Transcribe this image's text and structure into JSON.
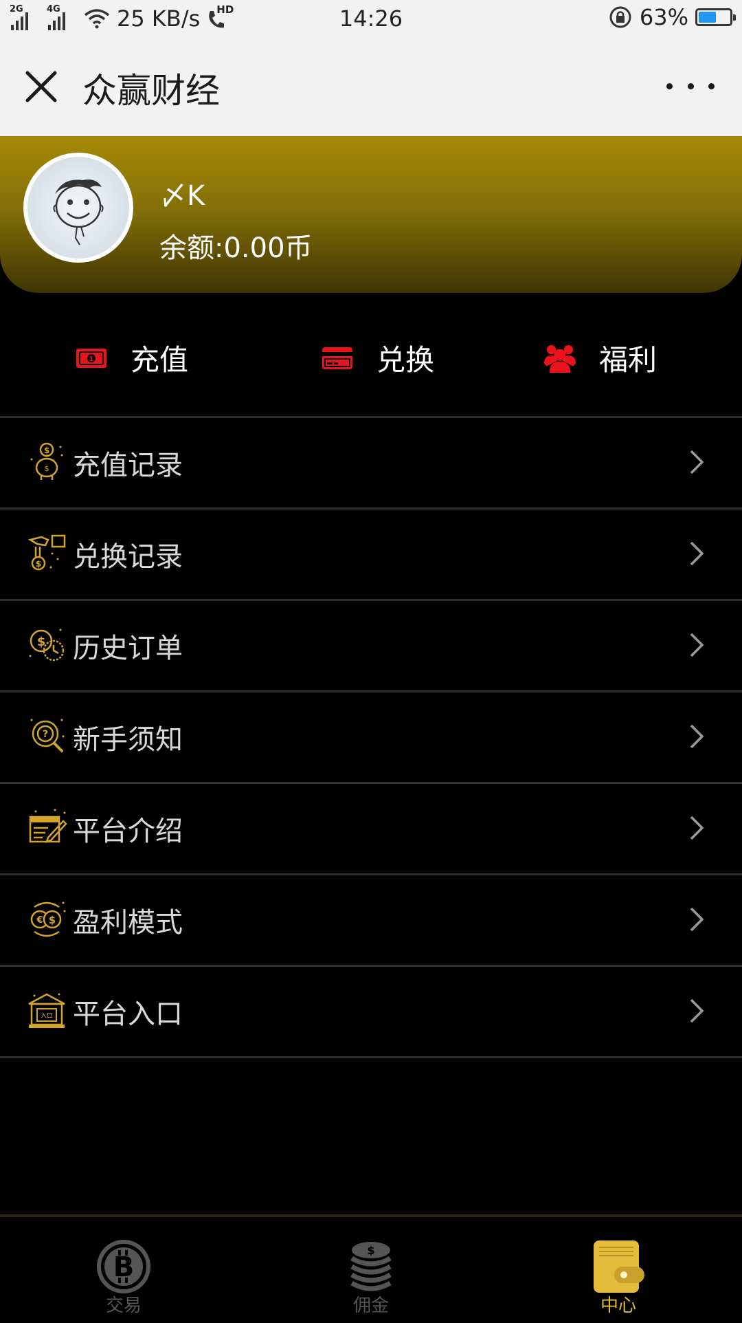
{
  "status_bar": {
    "signal1": "2G",
    "signal2": "4G",
    "net_speed": "25 KB/s",
    "call_badge": "HD",
    "time": "14:26",
    "battery": "63%",
    "battery_level": 0.63
  },
  "header": {
    "title": "众赢财经"
  },
  "profile": {
    "username": "〆K",
    "balance": "余额:0.00币"
  },
  "actions": [
    {
      "label": "充值",
      "icon": "cash-icon",
      "color": "#e8131b"
    },
    {
      "label": "兑换",
      "icon": "card-icon",
      "color": "#e8131b"
    },
    {
      "label": "福利",
      "icon": "group-icon",
      "color": "#e8131b"
    }
  ],
  "menu": [
    {
      "label": "充值记录",
      "icon": "piggy-bank-coin-icon"
    },
    {
      "label": "兑换记录",
      "icon": "coin-exchange-icon"
    },
    {
      "label": "历史订单",
      "icon": "clock-coin-icon"
    },
    {
      "label": "新手须知",
      "icon": "question-search-icon"
    },
    {
      "label": "平台介绍",
      "icon": "document-pen-icon"
    },
    {
      "label": "盈利模式",
      "icon": "coins-cycle-icon"
    },
    {
      "label": "平台入口",
      "icon": "building-entrance-icon",
      "badge": "入口"
    }
  ],
  "bottom_nav": [
    {
      "label": "交易",
      "icon": "bitcoin-icon",
      "active": false
    },
    {
      "label": "佣金",
      "icon": "coin-stack-icon",
      "active": false
    },
    {
      "label": "中心",
      "icon": "wallet-icon",
      "active": true
    }
  ],
  "colors": {
    "accent_gold": "#e2bb3a",
    "action_red": "#e8131b",
    "banner_top": "#a58a06",
    "banner_bottom": "#3e3503"
  }
}
